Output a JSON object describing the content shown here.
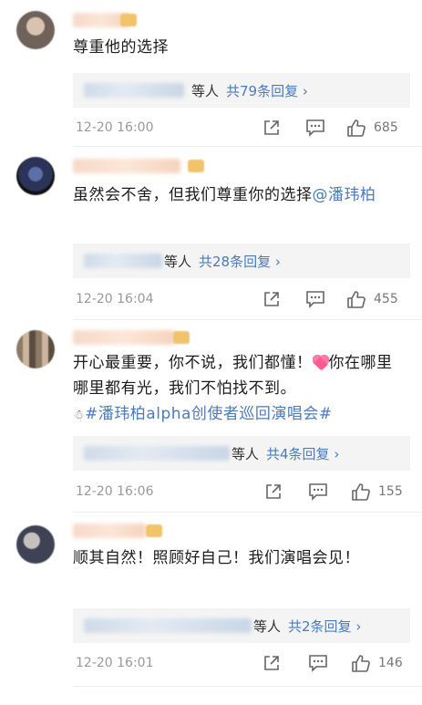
{
  "comments": [
    {
      "text_parts": [
        {
          "t": "尊重他的选择"
        }
      ],
      "reply_suffix": "等人",
      "reply_count": "共79条回复 ›",
      "time": "12-20 16:00",
      "likes": "685",
      "icons": [
        "share-icon",
        "comment-icon",
        "thumbs-up-icon"
      ]
    },
    {
      "text_parts": [
        {
          "t": "虽然会不舍，但我们尊重你的选择"
        },
        {
          "t": "@潘玮柏",
          "cls": "mention"
        }
      ],
      "reply_suffix": "等人",
      "reply_count": "共28条回复 ›",
      "time": "12-20 16:04",
      "likes": "455"
    },
    {
      "text_parts": [
        {
          "t": "开心最重要，你不说，我们都懂！"
        },
        {
          "emoji": "heart"
        },
        {
          "t": "你在哪里哪里都有光，我们不怕找不到。"
        },
        {
          "topic_icon": true
        },
        {
          "t": "#潘玮柏alpha创使者巡回演唱会#",
          "cls": "topic"
        }
      ],
      "reply_suffix": "等人",
      "reply_count": "共4条回复 ›",
      "time": "12-20 16:06",
      "likes": "155"
    },
    {
      "text_parts": [
        {
          "t": "顺其自然！照顾好自己！我们演唱会见！"
        }
      ],
      "reply_suffix": "等人",
      "reply_count": "共2条回复 ›",
      "time": "12-20 16:01",
      "likes": "146"
    }
  ]
}
